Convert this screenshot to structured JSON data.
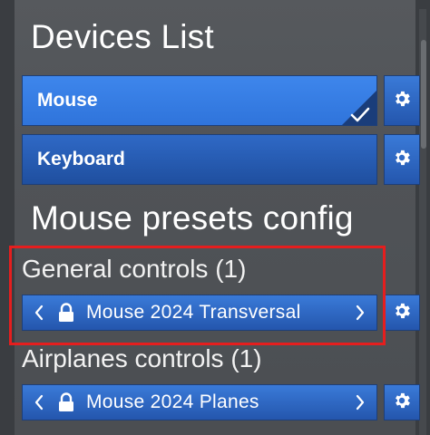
{
  "devices_list": {
    "title": "Devices List",
    "items": [
      {
        "label": "Mouse",
        "selected": true
      },
      {
        "label": "Keyboard",
        "selected": false
      }
    ]
  },
  "presets_config": {
    "title": "Mouse presets config",
    "sections": [
      {
        "label": "General controls (1)",
        "selected_preset": "Mouse 2024 Transversal",
        "locked": true
      },
      {
        "label": "Airplanes controls (1)",
        "selected_preset": "Mouse 2024 Planes",
        "locked": true
      }
    ]
  },
  "icons": {
    "gear": "gear-icon",
    "check": "check-icon",
    "lock": "lock-icon",
    "prev": "chevron-left-icon",
    "next": "chevron-right-icon"
  },
  "colors": {
    "selected_device": "#3e86ec",
    "button": "#2456ad",
    "panel": "#505357",
    "highlight": "#e51e1e"
  }
}
